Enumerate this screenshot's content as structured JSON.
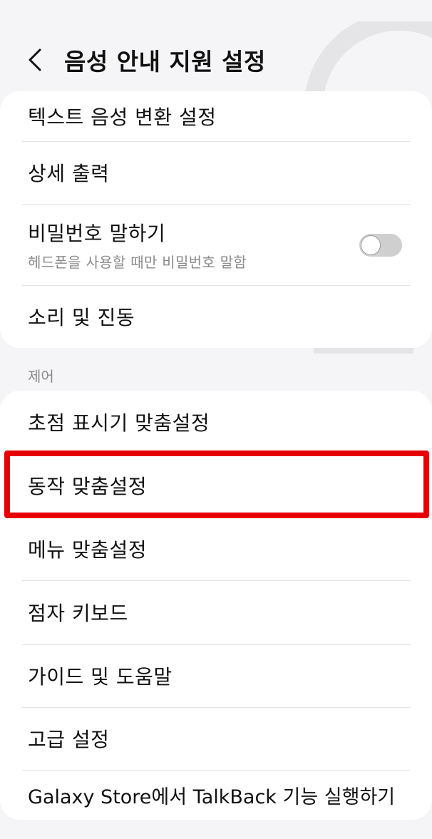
{
  "header": {
    "title": "음성 안내 지원 설정",
    "back_icon": "chevron-left-icon"
  },
  "card1": {
    "items": [
      {
        "label": "텍스트 음성 변환 설정"
      },
      {
        "label": "상세 출력"
      },
      {
        "label": "비밀번호 말하기",
        "sublabel": "헤드폰을 사용할 때만 비밀번호 말함",
        "toggle": "off"
      },
      {
        "label": "소리 및 진동"
      }
    ]
  },
  "section_control": {
    "label": "제어"
  },
  "card2": {
    "items": [
      {
        "label": "초점 표시기 맞춤설정"
      },
      {
        "label": "동작 맞춤설정"
      },
      {
        "label": "메뉴 맞춤설정"
      },
      {
        "label": "점자 키보드"
      },
      {
        "label": "가이드 및 도움말"
      },
      {
        "label": "고급 설정"
      },
      {
        "label": "Galaxy Store에서 TalkBack 기능 실행하기"
      }
    ]
  },
  "colors": {
    "highlight": "#e60000",
    "background": "#f5f5f7",
    "card": "#ffffff",
    "toggle_off_track": "#cfcfcf"
  }
}
